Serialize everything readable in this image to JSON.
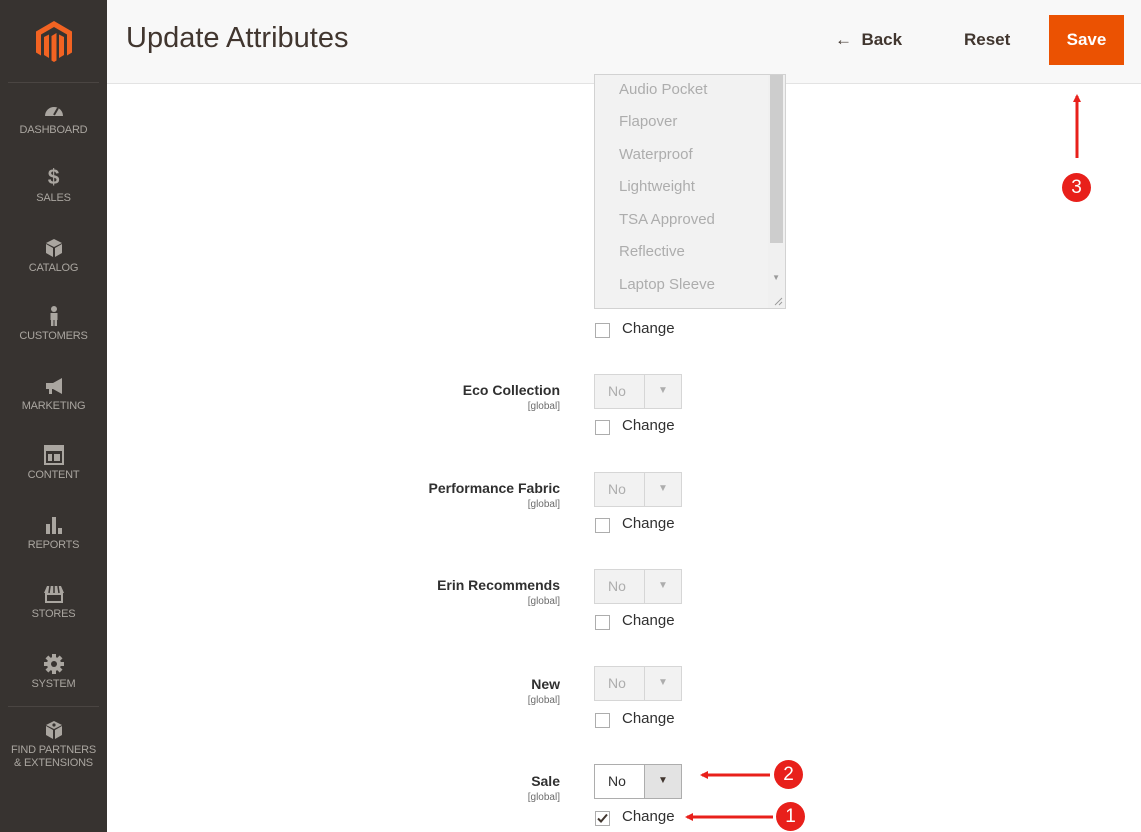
{
  "sidebar": {
    "items": [
      {
        "label": "DASHBOARD",
        "icon": "dashboard-icon"
      },
      {
        "label": "SALES",
        "icon": "dollar-icon"
      },
      {
        "label": "CATALOG",
        "icon": "box-icon"
      },
      {
        "label": "CUSTOMERS",
        "icon": "person-icon"
      },
      {
        "label": "MARKETING",
        "icon": "megaphone-icon"
      },
      {
        "label": "CONTENT",
        "icon": "layout-icon"
      },
      {
        "label": "REPORTS",
        "icon": "bar-chart-icon"
      },
      {
        "label": "STORES",
        "icon": "storefront-icon"
      },
      {
        "label": "SYSTEM",
        "icon": "gear-icon"
      },
      {
        "label_line1": "FIND PARTNERS",
        "label_line2": "& EXTENSIONS",
        "icon": "cubes-icon"
      }
    ]
  },
  "header": {
    "title": "Update Attributes",
    "back_label": "Back",
    "back_arrow": "←",
    "reset_label": "Reset",
    "save_label": "Save"
  },
  "multiselect": {
    "options": [
      "Audio Pocket",
      "Flapover",
      "Waterproof",
      "Lightweight",
      "TSA Approved",
      "Reflective",
      "Laptop Sleeve"
    ],
    "change_label": "Change",
    "change_checked": false
  },
  "attributes": [
    {
      "label": "Eco Collection",
      "scope": "[global]",
      "value": "No",
      "change_label": "Change",
      "change_checked": false,
      "enabled": false
    },
    {
      "label": "Performance Fabric",
      "scope": "[global]",
      "value": "No",
      "change_label": "Change",
      "change_checked": false,
      "enabled": false
    },
    {
      "label": "Erin Recommends",
      "scope": "[global]",
      "value": "No",
      "change_label": "Change",
      "change_checked": false,
      "enabled": false
    },
    {
      "label": "New",
      "scope": "[global]",
      "value": "No",
      "change_label": "Change",
      "change_checked": false,
      "enabled": false
    },
    {
      "label": "Sale",
      "scope": "[global]",
      "value": "No",
      "change_label": "Change",
      "change_checked": true,
      "enabled": true
    }
  ],
  "annotations": {
    "badge_1": "1",
    "badge_2": "2",
    "badge_3": "3"
  },
  "colors": {
    "accent": "#eb5202",
    "sidebar_bg": "#373330",
    "annotation_red": "#e8201b"
  }
}
